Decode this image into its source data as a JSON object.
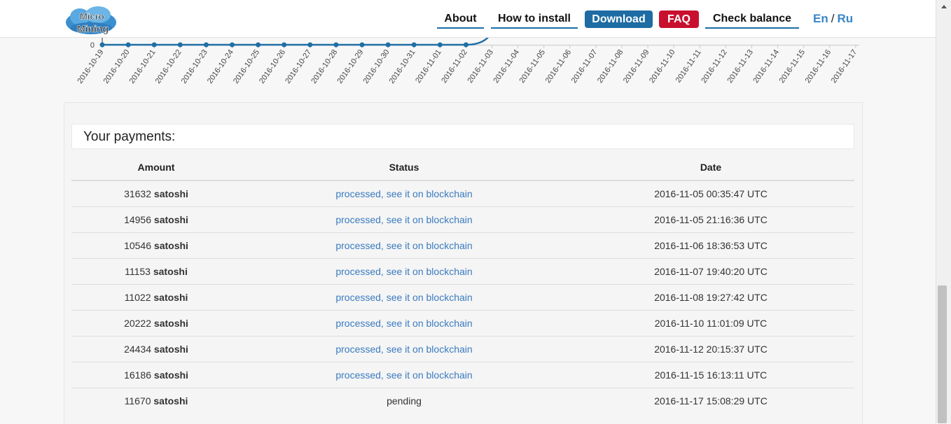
{
  "header": {
    "logo_text": [
      "Micro",
      "Mining"
    ],
    "nav": {
      "about": "About",
      "how_to_install": "How to install",
      "download": "Download",
      "faq": "FAQ",
      "check_balance": "Check balance"
    },
    "lang": {
      "en": "En",
      "sep": "/",
      "ru": "Ru"
    },
    "colors": {
      "download": "#1d6ca3",
      "faq": "#c8102e",
      "accent": "#3a86c8"
    }
  },
  "chart_data": {
    "type": "line",
    "y_tick_label": "0",
    "x": [
      "2016-10-19",
      "2016-10-20",
      "2016-10-21",
      "2016-10-22",
      "2016-10-23",
      "2016-10-24",
      "2016-10-25",
      "2016-10-26",
      "2016-10-27",
      "2016-10-28",
      "2016-10-29",
      "2016-10-30",
      "2016-10-31",
      "2016-11-01",
      "2016-11-02",
      "2016-11-03",
      "2016-11-04",
      "2016-11-05",
      "2016-11-06",
      "2016-11-07",
      "2016-11-08",
      "2016-11-09",
      "2016-11-10",
      "2016-11-11",
      "2016-11-12",
      "2016-11-13",
      "2016-11-14",
      "2016-11-15",
      "2016-11-16",
      "2016-11-17"
    ],
    "values": [
      0,
      0,
      0,
      0,
      0,
      0,
      0,
      0,
      0,
      0,
      0,
      0,
      0,
      0,
      0
    ],
    "line_color": "#1f6fa5"
  },
  "payments": {
    "title": "Your payments:",
    "columns": [
      "Amount",
      "Status",
      "Date"
    ],
    "unit": "satoshi",
    "rows": [
      {
        "amount": "31632",
        "status": "processed, see it on blockchain",
        "link": true,
        "date": "2016-11-05 00:35:47 UTC"
      },
      {
        "amount": "14956",
        "status": "processed, see it on blockchain",
        "link": true,
        "date": "2016-11-05 21:16:36 UTC"
      },
      {
        "amount": "10546",
        "status": "processed, see it on blockchain",
        "link": true,
        "date": "2016-11-06 18:36:53 UTC"
      },
      {
        "amount": "11153",
        "status": "processed, see it on blockchain",
        "link": true,
        "date": "2016-11-07 19:40:20 UTC"
      },
      {
        "amount": "11022",
        "status": "processed, see it on blockchain",
        "link": true,
        "date": "2016-11-08 19:27:42 UTC"
      },
      {
        "amount": "20222",
        "status": "processed, see it on blockchain",
        "link": true,
        "date": "2016-11-10 11:01:09 UTC"
      },
      {
        "amount": "24434",
        "status": "processed, see it on blockchain",
        "link": true,
        "date": "2016-11-12 20:15:37 UTC"
      },
      {
        "amount": "16186",
        "status": "processed, see it on blockchain",
        "link": true,
        "date": "2016-11-15 16:13:11 UTC"
      },
      {
        "amount": "11670",
        "status": "pending",
        "link": false,
        "date": "2016-11-17 15:08:29 UTC"
      }
    ]
  }
}
